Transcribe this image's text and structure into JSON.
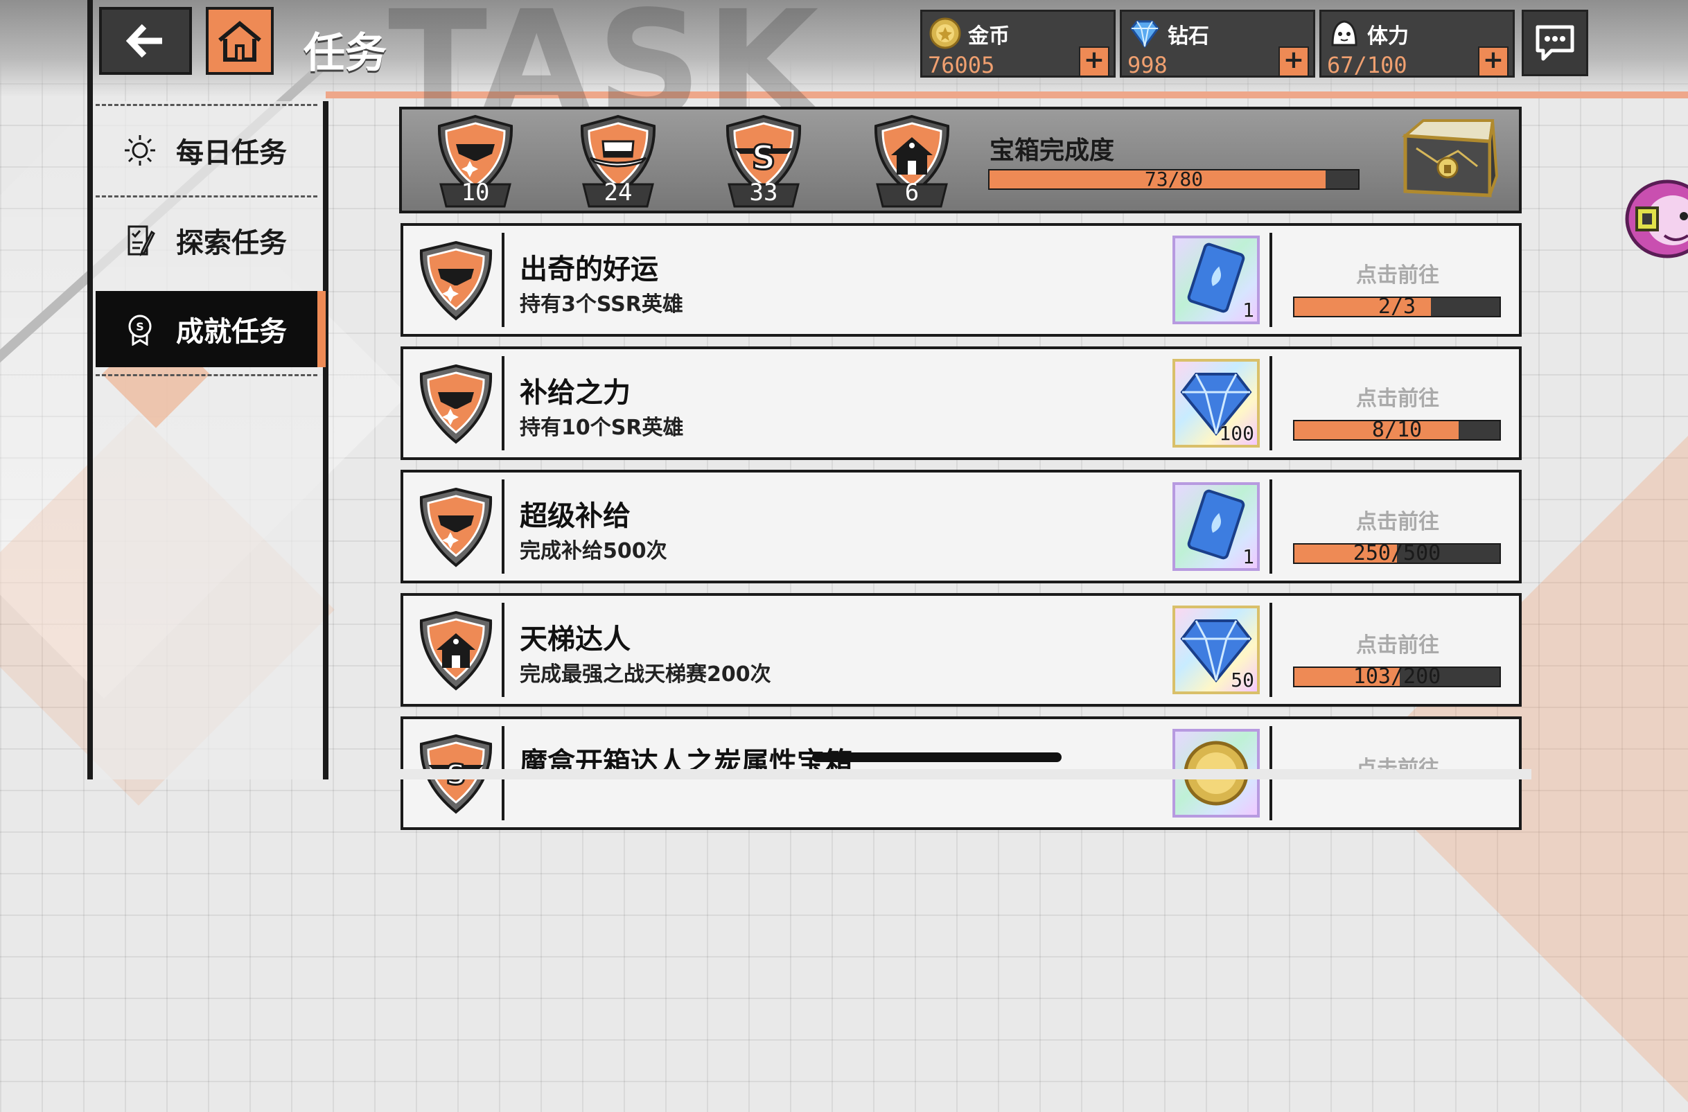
{
  "header": {
    "title": "任务",
    "watermark": "TASK"
  },
  "resources": [
    {
      "label": "金币",
      "value": "76005",
      "icon": "coin-icon"
    },
    {
      "label": "钻石",
      "value": "998",
      "icon": "diamond-icon"
    },
    {
      "label": "体力",
      "value": "67/100",
      "icon": "stamina-icon"
    }
  ],
  "plus_symbol": "+",
  "sidebar": {
    "items": [
      {
        "label": "每日任务",
        "icon": "sun-icon"
      },
      {
        "label": "探索任务",
        "icon": "checklist-icon"
      },
      {
        "label": "成就任务",
        "icon": "medal-icon",
        "active": true
      }
    ]
  },
  "progress_banner": {
    "badges": [
      {
        "icon": "mask-shield-icon",
        "count": "10"
      },
      {
        "icon": "hat-shield-icon",
        "count": "24"
      },
      {
        "icon": "s-emblem-shield-icon",
        "count": "33"
      },
      {
        "icon": "house-shield-icon",
        "count": "6"
      }
    ],
    "chest_title": "宝箱完成度",
    "chest_progress": "73/80",
    "chest_fraction": 0.9125
  },
  "tasks": [
    {
      "name": "出奇的好运",
      "desc": "持有3个SSR英雄",
      "badge": "mask-shield-icon",
      "reward": "card-icon",
      "reward_qty": "1",
      "action": "点击前往",
      "progress": "2/3",
      "fraction": 0.667
    },
    {
      "name": "补给之力",
      "desc": "持有10个SR英雄",
      "badge": "mask-shield-icon",
      "reward": "diamond-icon",
      "reward_qty": "100",
      "action": "点击前往",
      "progress": "8/10",
      "fraction": 0.8
    },
    {
      "name": "超级补给",
      "desc": "完成补给500次",
      "badge": "mask-shield-icon",
      "reward": "card-icon",
      "reward_qty": "1",
      "action": "点击前往",
      "progress": "250/500",
      "fraction": 0.5
    },
    {
      "name": "天梯达人",
      "desc": "完成最强之战天梯赛200次",
      "badge": "house-shield-icon",
      "reward": "diamond-icon",
      "reward_qty": "50",
      "action": "点击前往",
      "progress": "103/200",
      "fraction": 0.515
    },
    {
      "name": "魔盒开箱达人之炭属性宝箱",
      "desc": "",
      "badge": "s-emblem-shield-icon",
      "reward": "coin-icon",
      "reward_qty": "",
      "action": "点击前往",
      "progress": "",
      "fraction": 0
    }
  ],
  "colors": {
    "accent": "#ee8a55",
    "dark": "#1a1a1a",
    "panel": "#f4f4f4"
  }
}
